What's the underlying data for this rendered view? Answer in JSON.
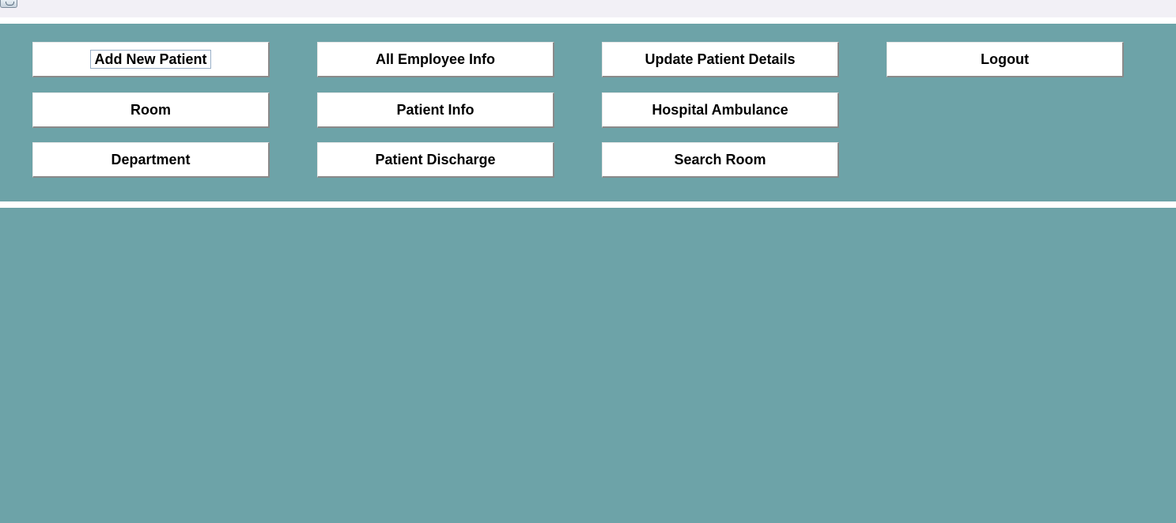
{
  "window": {
    "app_icon": "java-cup-icon"
  },
  "menu": {
    "row1": {
      "add_new_patient": "Add New Patient",
      "all_employee_info": "All Employee Info",
      "update_patient_details": "Update Patient Details",
      "logout": "Logout"
    },
    "row2": {
      "room": "Room",
      "patient_info": "Patient Info",
      "hospital_ambulance": "Hospital Ambulance"
    },
    "row3": {
      "department": "Department",
      "patient_discharge": "Patient Discharge",
      "search_room": "Search Room"
    },
    "focused_button": "Add New Patient"
  },
  "colors": {
    "panel": "#6da3a8",
    "button": "#ffffff",
    "divider": "#ffffff",
    "titlebar": "#f2f0f6"
  }
}
